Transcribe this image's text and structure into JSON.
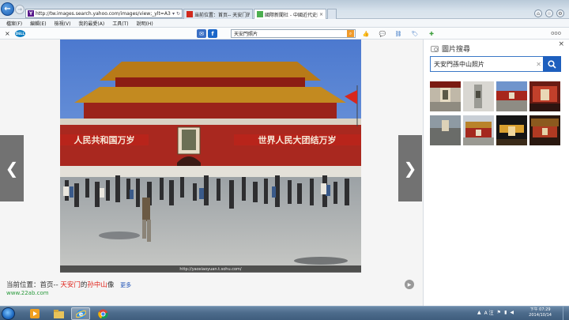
{
  "browser": {
    "address_url": "http://tw.images.search.yahoo.com/images/view;_ylt=A3eg9cHdCI",
    "tabs": [
      {
        "label": "当前位置：首页-- 天安门的...",
        "favicon": "red-page-icon"
      },
      {
        "label": "國際新聞社 - 中國近代史或解...",
        "favicon": "green-page-icon"
      }
    ],
    "menu": [
      "檔案(F)",
      "編輯(E)",
      "檢視(V)",
      "我的最愛(A)",
      "工具(T)",
      "說明(H)"
    ],
    "toolbar_search_value": "天安門照片",
    "toolbar_more": "ooo"
  },
  "viewer": {
    "photo_caption": "http://yaoxiaoyuan.t.sohu.com/",
    "banner_left": "人民共和国万岁",
    "banner_right": "世界人民大团结万岁",
    "breadcrumb_prefix": "当前位置：首页-- ",
    "breadcrumb_red1": "天安门",
    "breadcrumb_mid": "的",
    "breadcrumb_red2": "孙中山",
    "breadcrumb_suffix": "像",
    "more_label": "更多",
    "source_domain": "www.22ab.com"
  },
  "panel": {
    "title": "圖片搜尋",
    "search_value": "天安門孫中山照片"
  },
  "taskbar": {
    "time": "下午 07:29",
    "date": "2014/10/14",
    "ime": "A 注"
  },
  "colors": {
    "accent": "#1e5fbe",
    "breadcrumb_red": "#e0241b",
    "domain_green": "#2a9a3c"
  }
}
